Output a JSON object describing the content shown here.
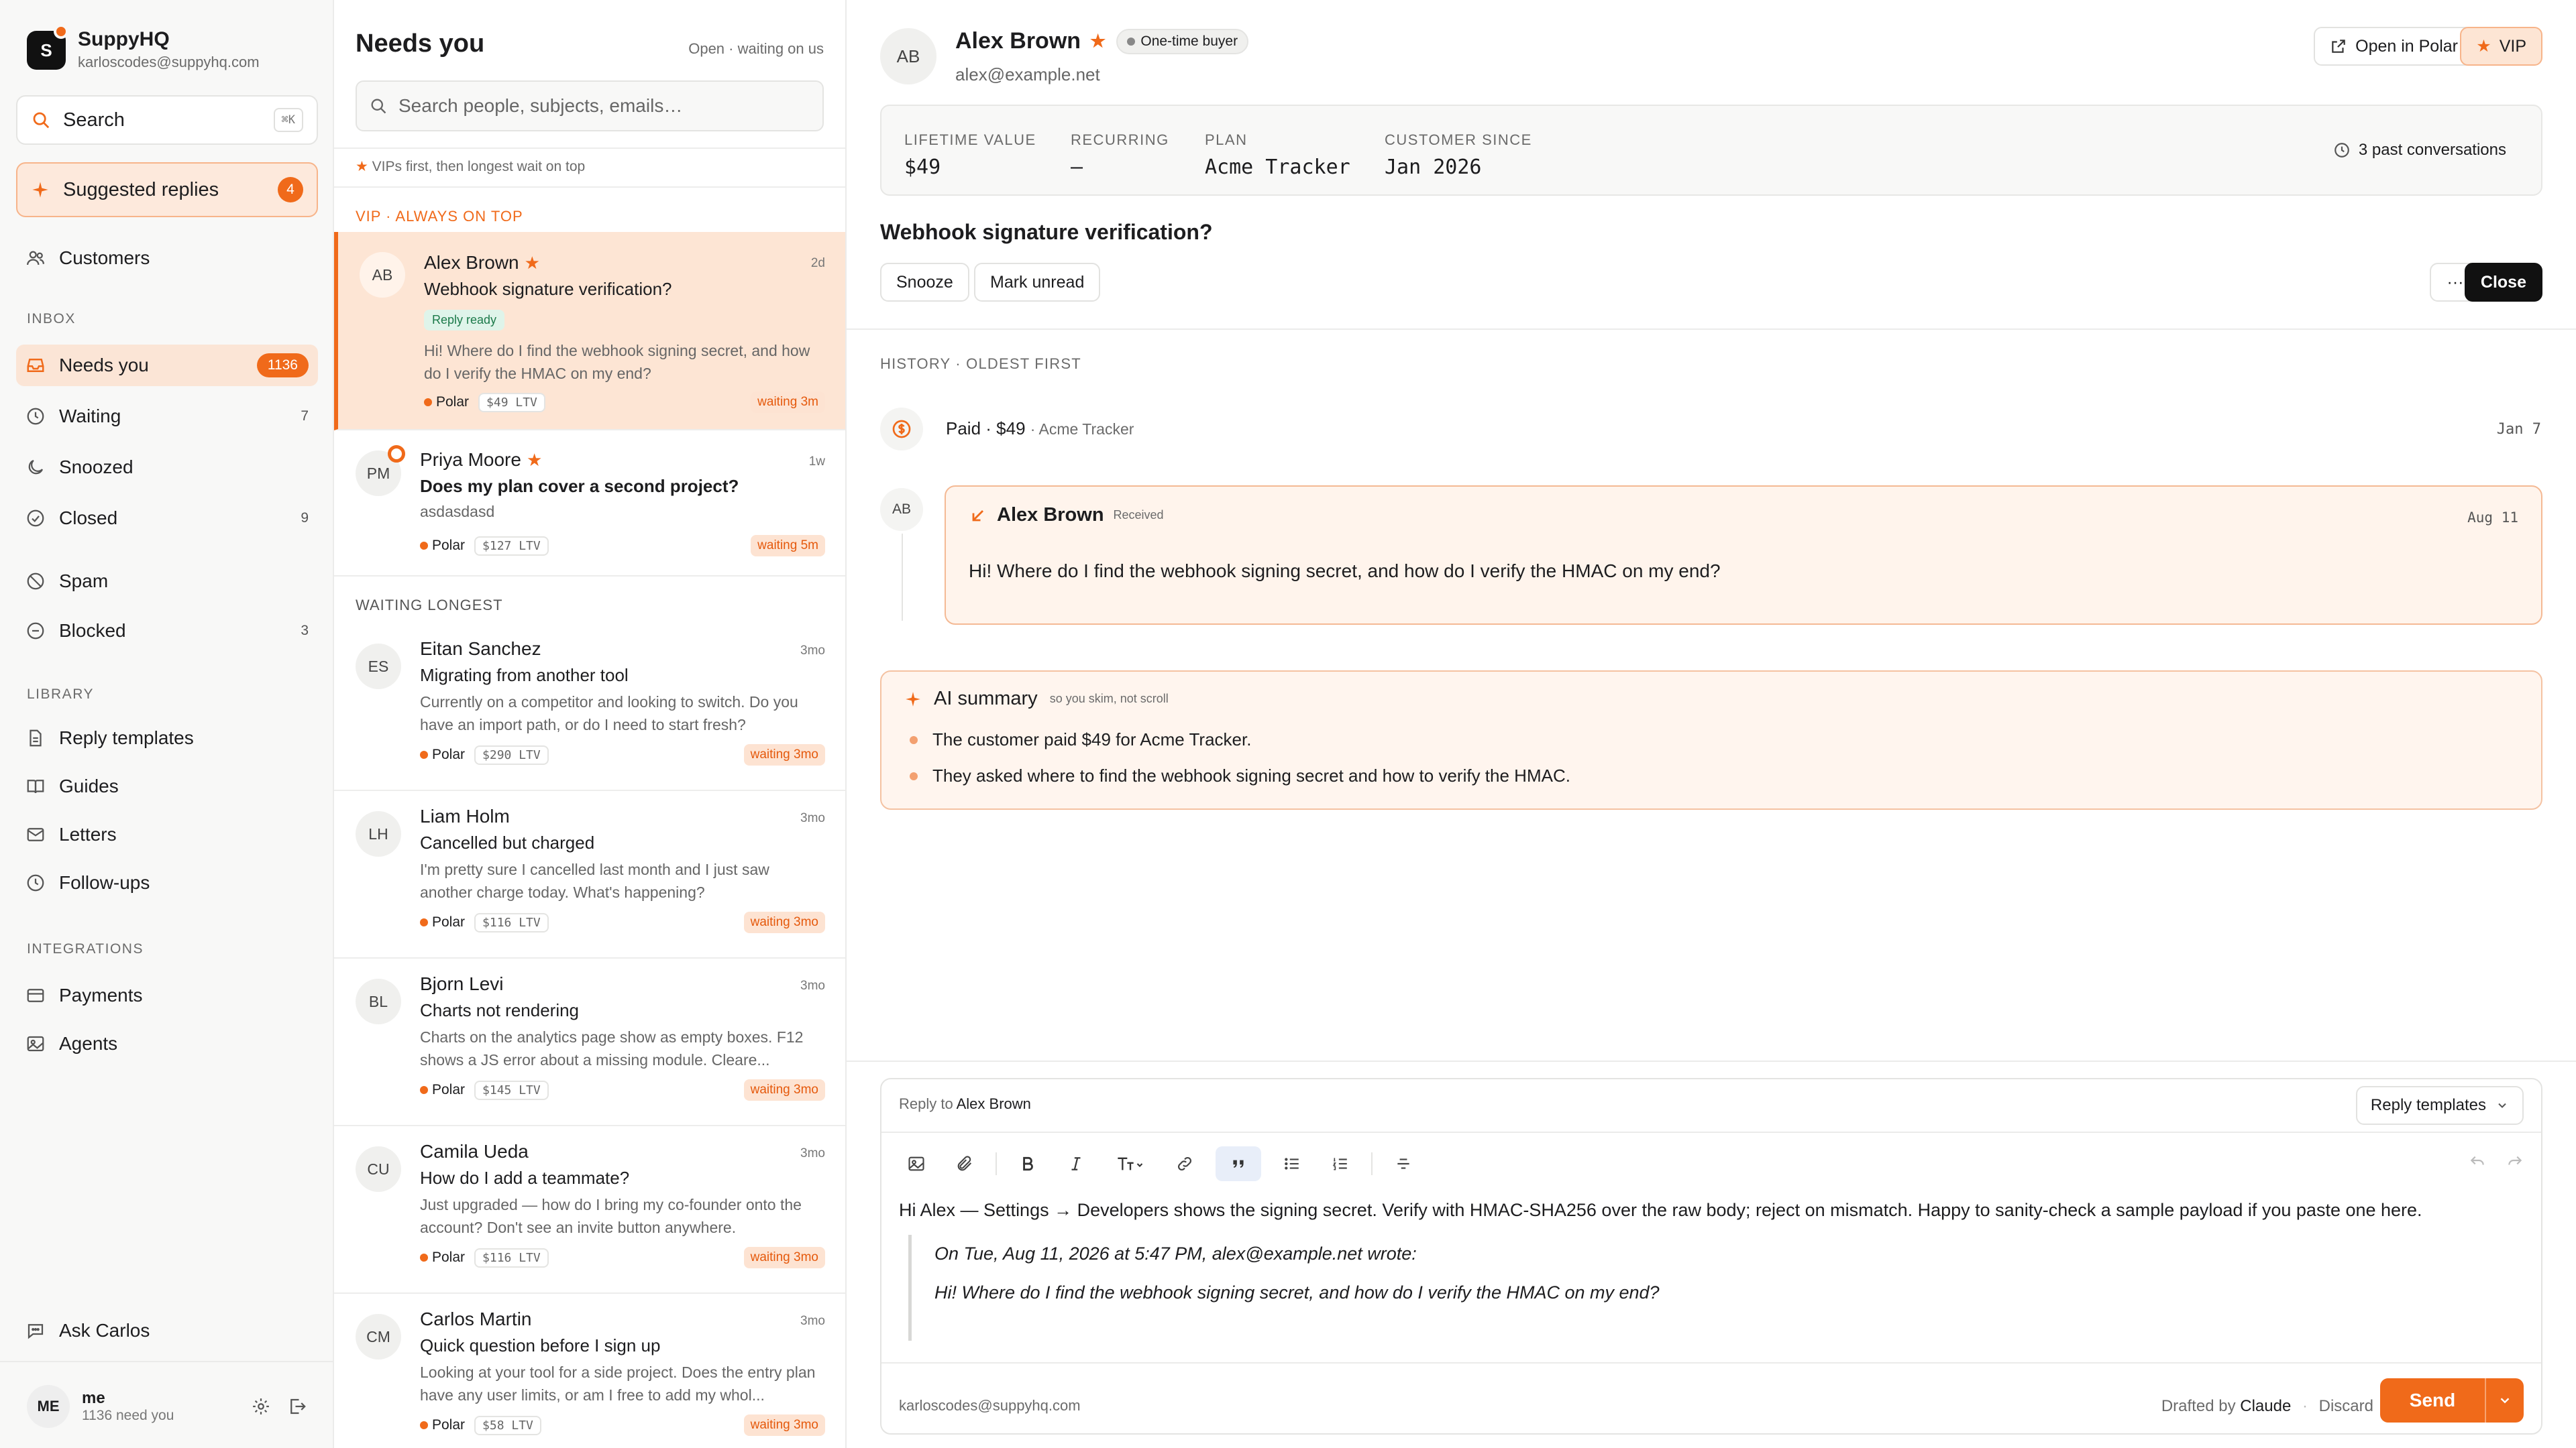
{
  "colors": {
    "accent": "#f06a1a",
    "accent_soft": "#fde5d4",
    "ok": "#1c7a4a"
  },
  "brand": {
    "name": "SuppyHQ",
    "email": "karloscodes@suppyhq.com",
    "initial": "S"
  },
  "search": {
    "label": "Search",
    "shortcut": "⌘K"
  },
  "suggested": {
    "label": "Suggested replies",
    "count": "4"
  },
  "nav": {
    "customers": "Customers",
    "inbox_header": "INBOX",
    "needs_you": {
      "label": "Needs you",
      "count": "1136"
    },
    "waiting": {
      "label": "Waiting",
      "count": "7"
    },
    "snoozed": {
      "label": "Snoozed"
    },
    "closed": {
      "label": "Closed",
      "count": "9"
    },
    "spam": {
      "label": "Spam"
    },
    "blocked": {
      "label": "Blocked",
      "count": "3"
    },
    "library_header": "LIBRARY",
    "reply_templates": "Reply templates",
    "guides": "Guides",
    "letters": "Letters",
    "followups": "Follow-ups",
    "integrations_header": "INTEGRATIONS",
    "payments": "Payments",
    "agents": "Agents",
    "ask": "Ask Carlos"
  },
  "me": {
    "initials": "ME",
    "name": "me",
    "sub": "1136 need you"
  },
  "list": {
    "title": "Needs you",
    "meta": "Open · waiting on us",
    "search_placeholder": "Search people, subjects, emails…",
    "note": "VIPs first, then longest wait on top",
    "vip_header": "VIP · ALWAYS ON TOP",
    "waiting_header": "WAITING LONGEST",
    "items": [
      {
        "initials": "AB",
        "name": "Alex Brown",
        "star": "★",
        "time": "2d",
        "subject": "Webhook signature verification?",
        "tag": "Reply ready",
        "preview": "Hi! Where do I find the webhook signing secret, and how do I verify the HMAC on my end?",
        "source": "Polar",
        "ltv": "$49 LTV",
        "wait": "waiting 3m"
      },
      {
        "initials": "PM",
        "name": "Priya Moore",
        "star": "★",
        "time": "1w",
        "subject": "Does my plan cover a second project?",
        "preview": "asdasdasd",
        "source": "Polar",
        "ltv": "$127 LTV",
        "wait": "waiting 5m"
      },
      {
        "initials": "ES",
        "name": "Eitan Sanchez",
        "time": "3mo",
        "subject": "Migrating from another tool",
        "preview": "Currently on a competitor and looking to switch. Do you have an import path, or do I need to start fresh?",
        "source": "Polar",
        "ltv": "$290 LTV",
        "wait": "waiting 3mo"
      },
      {
        "initials": "LH",
        "name": "Liam Holm",
        "time": "3mo",
        "subject": "Cancelled but charged",
        "preview": "I'm pretty sure I cancelled last month and I just saw another charge today. What's happening?",
        "source": "Polar",
        "ltv": "$116 LTV",
        "wait": "waiting 3mo"
      },
      {
        "initials": "BL",
        "name": "Bjorn Levi",
        "time": "3mo",
        "subject": "Charts not rendering",
        "preview": "Charts on the analytics page show as empty boxes. F12 shows a JS error about a missing module. Cleare...",
        "source": "Polar",
        "ltv": "$145 LTV",
        "wait": "waiting 3mo"
      },
      {
        "initials": "CU",
        "name": "Camila Ueda",
        "time": "3mo",
        "subject": "How do I add a teammate?",
        "preview": "Just upgraded — how do I bring my co-founder onto the account? Don't see an invite button anywhere.",
        "source": "Polar",
        "ltv": "$116 LTV",
        "wait": "waiting 3mo"
      },
      {
        "initials": "CM",
        "name": "Carlos Martin",
        "time": "3mo",
        "subject": "Quick question before I sign up",
        "preview": "Looking at your tool for a side project. Does the entry plan have any user limits, or am I free to add my whol...",
        "source": "Polar",
        "ltv": "$58 LTV",
        "wait": "waiting 3mo"
      }
    ]
  },
  "convo": {
    "initials": "AB",
    "name": "Alex Brown",
    "star": "★",
    "badge": "One-time buyer",
    "email": "alex@example.net",
    "open_polar": "Open in Polar",
    "vip": "VIP",
    "stats": [
      {
        "k": "LIFETIME VALUE",
        "v": "$49"
      },
      {
        "k": "RECURRING",
        "v": "—"
      },
      {
        "k": "PLAN",
        "v": "Acme Tracker"
      },
      {
        "k": "CUSTOMER SINCE",
        "v": "Jan 2026"
      }
    ],
    "past": "3 past conversations",
    "subject": "Webhook signature verification?",
    "snooze": "Snooze",
    "mark_unread": "Mark unread",
    "more": "···",
    "close": "Close",
    "history": "HISTORY · OLDEST FIRST",
    "paid": {
      "title": "Paid · $49",
      "product": "· Acme Tracker",
      "date": "Jan 7"
    },
    "message": {
      "author": "Alex Brown",
      "status": "Received",
      "date": "Aug 11",
      "body": "Hi! Where do I find the webhook signing secret, and how do I verify the HMAC on my end?"
    },
    "ai": {
      "title": "AI summary",
      "sub": "so you skim, not scroll",
      "points": [
        "The customer paid $49 for Acme Tracker.",
        "They asked where to find the webhook signing secret and how to verify the HMAC."
      ]
    }
  },
  "composer": {
    "reply_to_prefix": "Reply to",
    "reply_to_name": "Alex Brown",
    "templates": "Reply templates",
    "body": "Hi Alex — Settings → Developers shows the signing secret. Verify with HMAC-SHA256 over the raw body; reject on mismatch. Happy to sanity-check a sample payload if you paste one here.",
    "quote_head": "On Tue, Aug 11, 2026 at 5:47 PM, alex@example.net wrote:",
    "quote_body": "Hi! Where do I find the webhook signing secret, and how do I verify the HMAC on my end?",
    "from": "karloscodes@suppyhq.com",
    "drafted_prefix": "Drafted by",
    "drafted_by": "Claude",
    "discard": "Discard",
    "send": "Send"
  }
}
